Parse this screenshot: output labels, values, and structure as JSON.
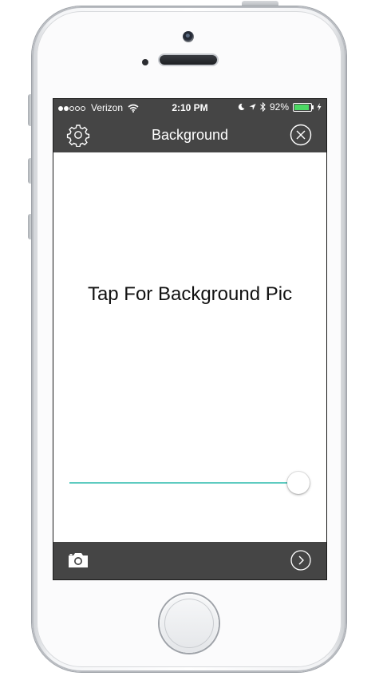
{
  "status_bar": {
    "signal_bars_filled": 2,
    "signal_bars_total": 5,
    "carrier": "Verizon",
    "time": "2:10 PM",
    "battery_percent": "92%",
    "battery_level": 0.92,
    "battery_color": "#4cd964",
    "icons": [
      "wifi-icon",
      "moon-icon",
      "location-arrow-icon",
      "bluetooth-icon",
      "charging-bolt-icon"
    ]
  },
  "nav_bar": {
    "title": "Background",
    "left_icon": "gear-icon",
    "right_icon": "close-circle-icon"
  },
  "main": {
    "prompt": "Tap For Background Pic",
    "slider_value": 0.95,
    "slider_color": "#5ecbc0"
  },
  "toolbar": {
    "left_icon": "camera-icon",
    "right_icon": "chevron-right-circle-icon"
  }
}
